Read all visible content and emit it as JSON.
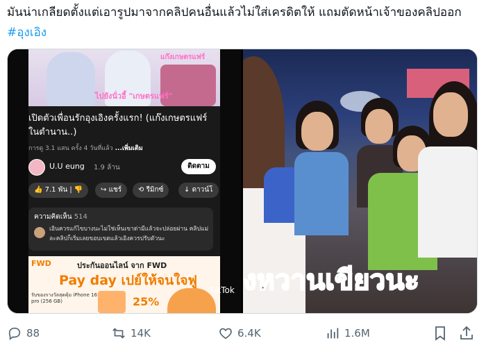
{
  "tweet": {
    "text": "มันน่าเกลียดตั้งแต่เอารูปมาจากคลิปคนอื่นแล้วไม่ใส่เครดิตให้ แถมตัดหน้าเจ้าของคลิปออก ",
    "hashtag": "#อุงเอิง"
  },
  "left_media": {
    "overlay_top_right": "แก๊งเกษตรแฟร์",
    "overlay_center": "ไปยังนั่วอี้ \"เกษตรแฟร์\"",
    "video_title": "เปิดตัวเพื่อนรักอุงเอิงครั้งแรก! (แก๊งเกษตรแฟร์ในตำนาน..)",
    "video_meta": "การดู 3.1 แสน ครั้ง  4 วันที่แล้ว",
    "more_label": "...เพิ่มเติม",
    "channel_name": "U.U eung",
    "channel_subs": "1.9 ล้าน",
    "follow_label": "ติดตาม",
    "actions": {
      "like": "7.1 พัน",
      "share": "แชร์",
      "remix": "รีมิกซ์",
      "download": "ดาวน์โ"
    },
    "comments_label": "ความคิดเห็น",
    "comments_count": "514",
    "comment_text": "เอินควรแก้ไขบางนะไม่ใช่เห็นเขาด่ามีแล้วจะปล่อยผ่าน คลิปแม่ละคลิปก็เริ่มเลยขอบเขตแล้วเอิงควรปรับตัวนะ",
    "ad_brand": "FWD",
    "ad_headline": "ประกันออนไลน์ จาก FWD",
    "ad_big_text": "Pay day เปย์ให้จนใจฟู",
    "ad_small_text": "รับของรางวัลสุดคุ้ม iPhone 16 pro (256 GB)",
    "ad_percent": "25%",
    "tiktok_label": "TikTok"
  },
  "right_media": {
    "caption": "งหวานเขียวนะ"
  },
  "action_bar": {
    "replies": "88",
    "reposts": "14K",
    "likes": "6.4K",
    "views": "1.6M"
  },
  "colors": {
    "hashtag": "#1d9bf0",
    "action_gray": "#536471",
    "caption_green": "#2d6a2b"
  }
}
